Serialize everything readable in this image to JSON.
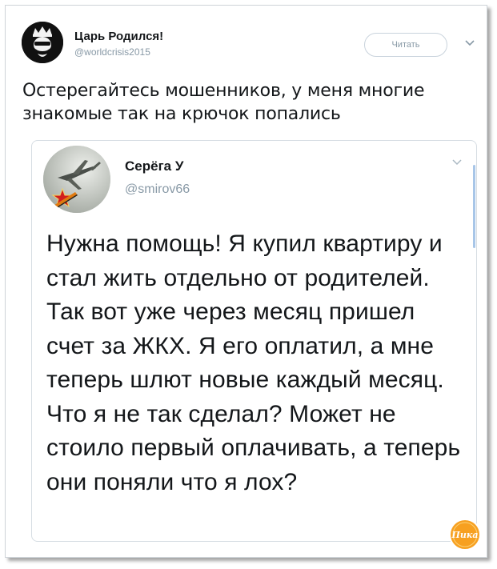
{
  "tweet": {
    "author": {
      "name": "Царь Родился!",
      "handle": "@worldcrisis2015",
      "avatar_icon": "crowned-bearded-face-icon"
    },
    "follow_button_label": "Читать",
    "menu_icon": "chevron-down-icon",
    "text": "Остерегайтесь мошенников, у меня многие знакомые так на крючок попались"
  },
  "quoted_tweet": {
    "author": {
      "name": "Серёга У",
      "handle": "@smirov66",
      "avatar_icon": "red-star-aircraft-icon"
    },
    "menu_icon": "chevron-down-icon",
    "text": "Нужна помощь! Я купил квартиру и стал жить отдельно от родителей. Так вот уже через месяц пришел счет за ЖКХ. Я его оплатил, а мне теперь шлют новые каждый месяц. Что я не так сделал? Может не стоило первый оплачивать, а теперь они поняли что я лох?"
  },
  "watermark": {
    "text": "Пика",
    "icon": "site-logo-icon"
  },
  "colors": {
    "text_primary": "#14171a",
    "text_secondary": "#8899a6",
    "border": "#d6dde3",
    "scroll_accent": "#a8c6e8",
    "watermark_orange": "#f7a020"
  }
}
